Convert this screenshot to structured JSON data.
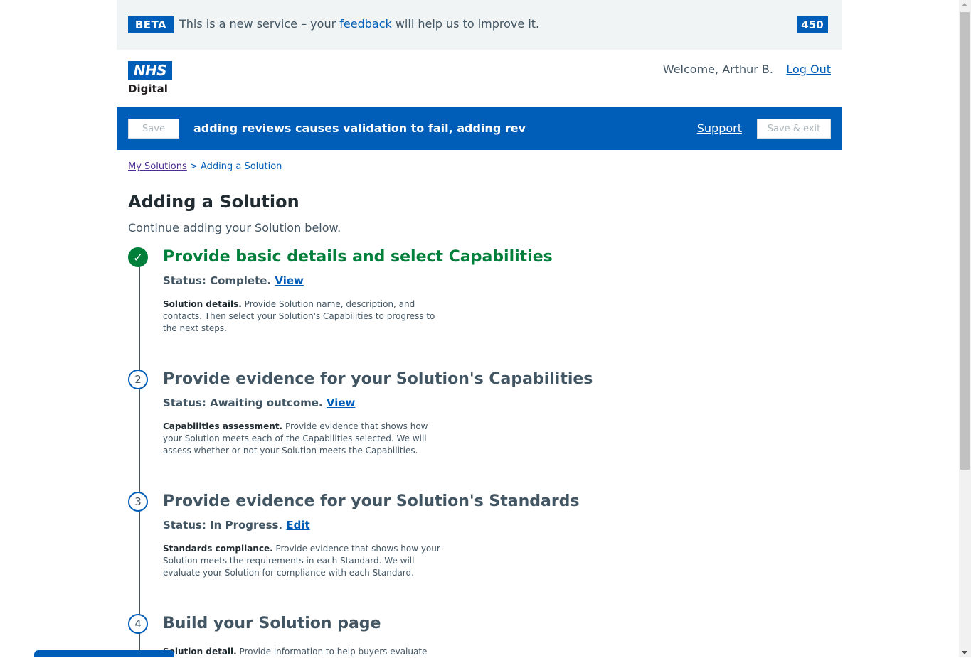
{
  "beta_bar": {
    "tag": "BETA",
    "text_before": "This is a new service – your ",
    "link": "feedback",
    "text_after": " will help us to improve it.",
    "counter": "450"
  },
  "header": {
    "logo": "NHS",
    "logo_subtitle": "Digital",
    "welcome": "Welcome, Arthur B.",
    "logout": "Log Out"
  },
  "action_bar": {
    "save": "Save",
    "title": "adding reviews causes validation to fail, adding rev",
    "support": "Support",
    "save_exit": "Save & exit"
  },
  "breadcrumb": {
    "link": "My Solutions",
    "separator": " > ",
    "current": "Adding a Solution"
  },
  "page": {
    "title": "Adding a Solution",
    "intro": "Continue adding your Solution below."
  },
  "steps": [
    {
      "marker": "✓",
      "title": "Provide basic details and select Capabilities",
      "status": "Status: Complete. ",
      "action": "View",
      "desc_bold": "Solution details.",
      "desc": " Provide Solution name, description, and contacts. Then select your Solution's Capabilities to progress to the next steps."
    },
    {
      "marker": "2",
      "title": "Provide evidence for your Solution's Capabilities",
      "status": "Status: Awaiting outcome. ",
      "action": "View",
      "desc_bold": "Capabilities assessment.",
      "desc": " Provide evidence that shows how your Solution meets each of the Capabilities selected. We will assess whether or not your Solution meets the Capabilities."
    },
    {
      "marker": "3",
      "title": "Provide evidence for your Solution's Standards",
      "status": "Status: In Progress. ",
      "action": "Edit",
      "desc_bold": "Standards compliance.",
      "desc": " Provide evidence that shows how your Solution meets the requirements in each Standard. We will evaluate your Solution for compliance with each Standard."
    },
    {
      "marker": "4",
      "title": "Build your Solution page",
      "desc_bold": "Solution detail.",
      "desc": " Provide information to help buyers evaluate"
    }
  ],
  "colors": {
    "nhs_blue": "#005eb8",
    "complete_green": "#007f3b",
    "beta_bg": "#f0f4f5"
  }
}
